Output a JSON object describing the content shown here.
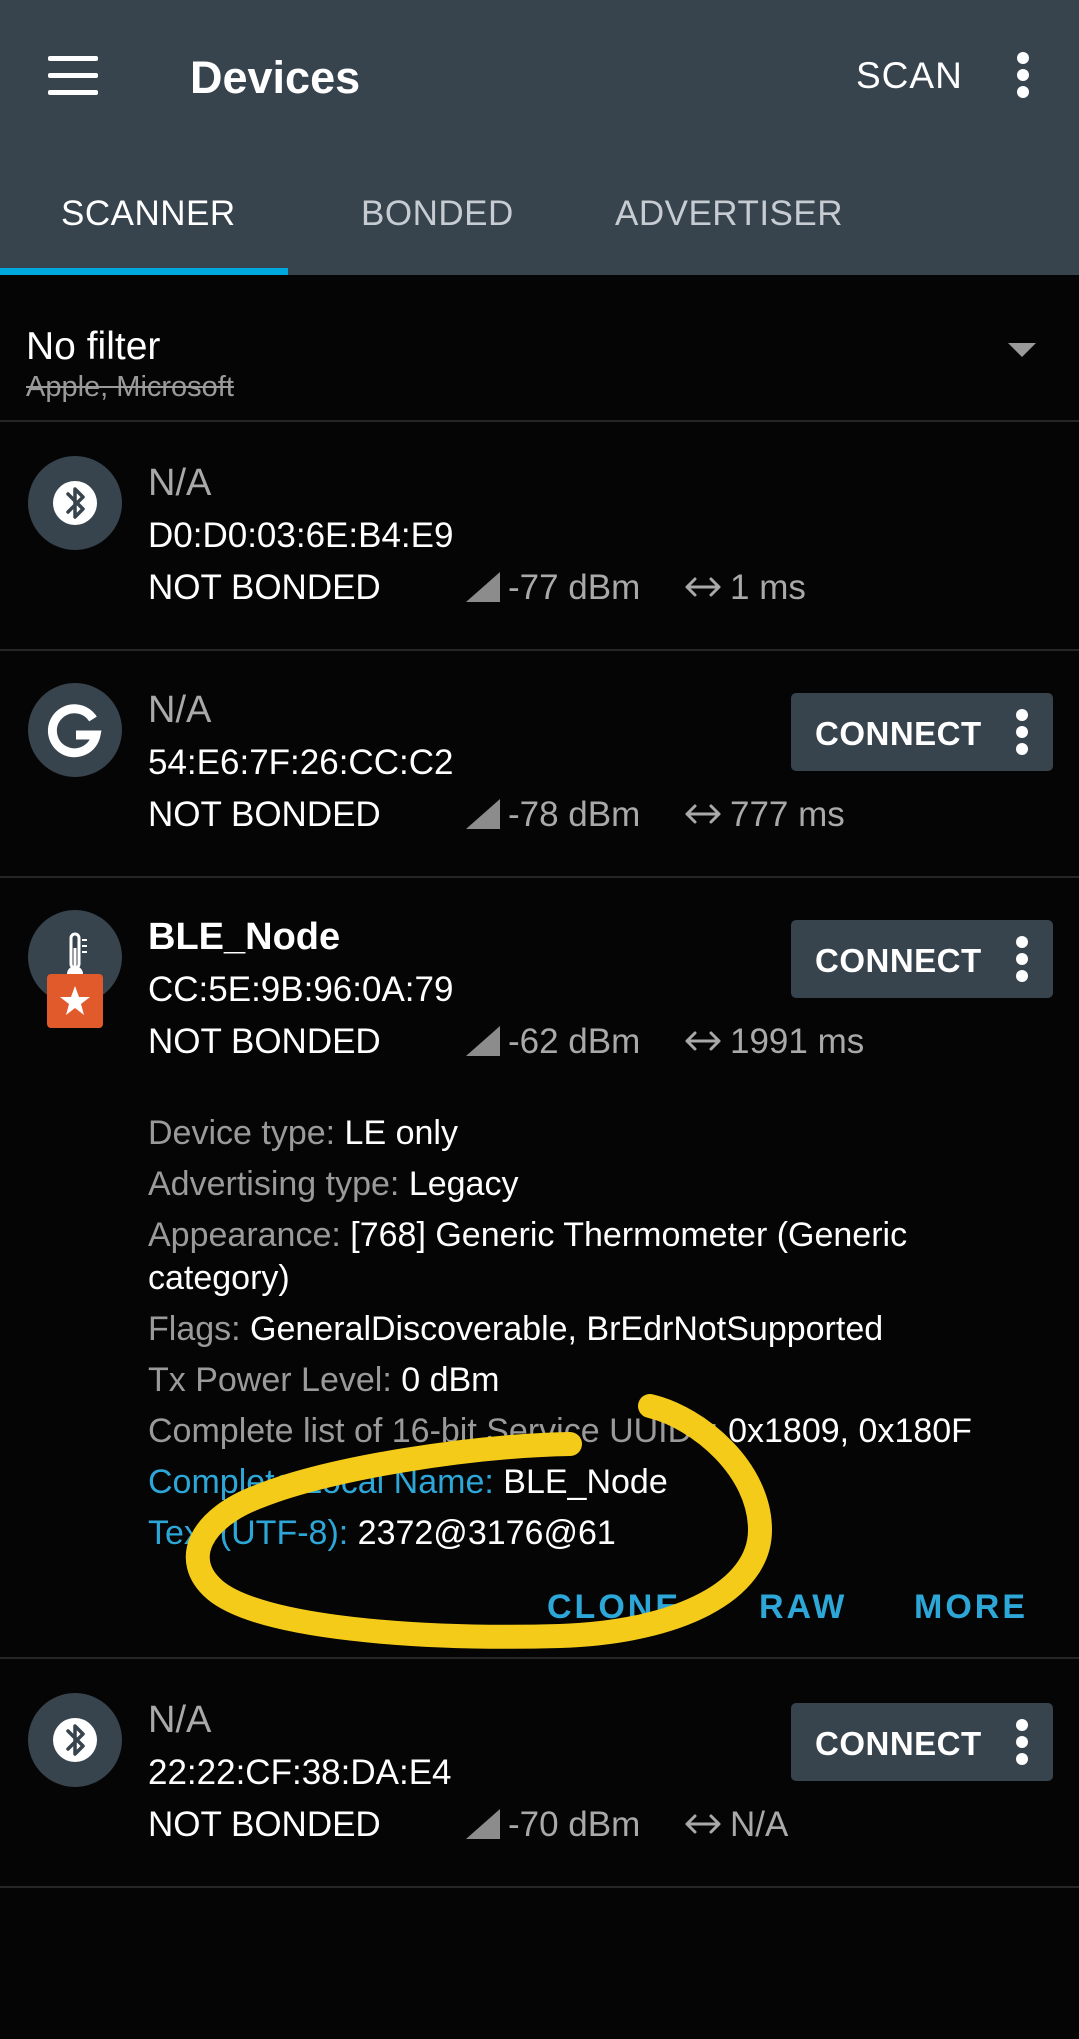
{
  "appbar": {
    "title": "Devices",
    "scan_label": "SCAN",
    "menu_icon": "hamburger-icon",
    "more_icon": "vertical-dots-icon"
  },
  "tabs": [
    {
      "label": "SCANNER",
      "active": true
    },
    {
      "label": "BONDED",
      "active": false
    },
    {
      "label": "ADVERTISER",
      "active": false
    }
  ],
  "filter": {
    "title": "No filter",
    "subtitle": "Apple, Microsoft"
  },
  "devices": [
    {
      "icon": "bluetooth-icon",
      "name": "N/A",
      "address": "D0:D0:03:6E:B4:E9",
      "bond": "NOT BONDED",
      "rssi": "-77 dBm",
      "interval": "1 ms",
      "connect": null
    },
    {
      "icon": "google-icon",
      "name": "N/A",
      "address": "54:E6:7F:26:CC:C2",
      "bond": "NOT BONDED",
      "rssi": "-78 dBm",
      "interval": "777 ms",
      "connect": "CONNECT"
    },
    {
      "icon": "thermometer-icon",
      "badge": "star-icon",
      "name": "BLE_Node",
      "address": "CC:5E:9B:96:0A:79",
      "bond": "NOT BONDED",
      "rssi": "-62 dBm",
      "interval": "1991 ms",
      "connect": "CONNECT",
      "details": [
        {
          "key": "Device type:",
          "value": "LE only"
        },
        {
          "key": "Advertising type:",
          "value": "Legacy"
        },
        {
          "key": "Appearance:",
          "value": "[768] Generic Thermometer (Generic category)"
        },
        {
          "key": "Flags:",
          "value": "GeneralDiscoverable, BrEdrNotSupported"
        },
        {
          "key": "Tx Power Level:",
          "value": "0 dBm"
        },
        {
          "key": "Complete list of 16-bit Service UUIDs:",
          "value": "0x1809, 0x180F"
        },
        {
          "key": "Complete Local Name:",
          "value": "BLE_Node"
        },
        {
          "key": "Text (UTF-8):",
          "value": "2372@3176@61"
        }
      ],
      "actions": {
        "clone": "CLONE",
        "raw": "RAW",
        "more": "MORE"
      }
    },
    {
      "icon": "bluetooth-icon",
      "name": "N/A",
      "address": "22:22:CF:38:DA:E4",
      "bond": "NOT BONDED",
      "rssi": "-70 dBm",
      "interval": "N/A",
      "connect": "CONNECT"
    }
  ],
  "colors": {
    "appbar": "#37434d",
    "accent": "#00a8e0",
    "link": "#2ca7d8",
    "badge": "#e05a2c",
    "annotation": "#f5cb1a"
  }
}
